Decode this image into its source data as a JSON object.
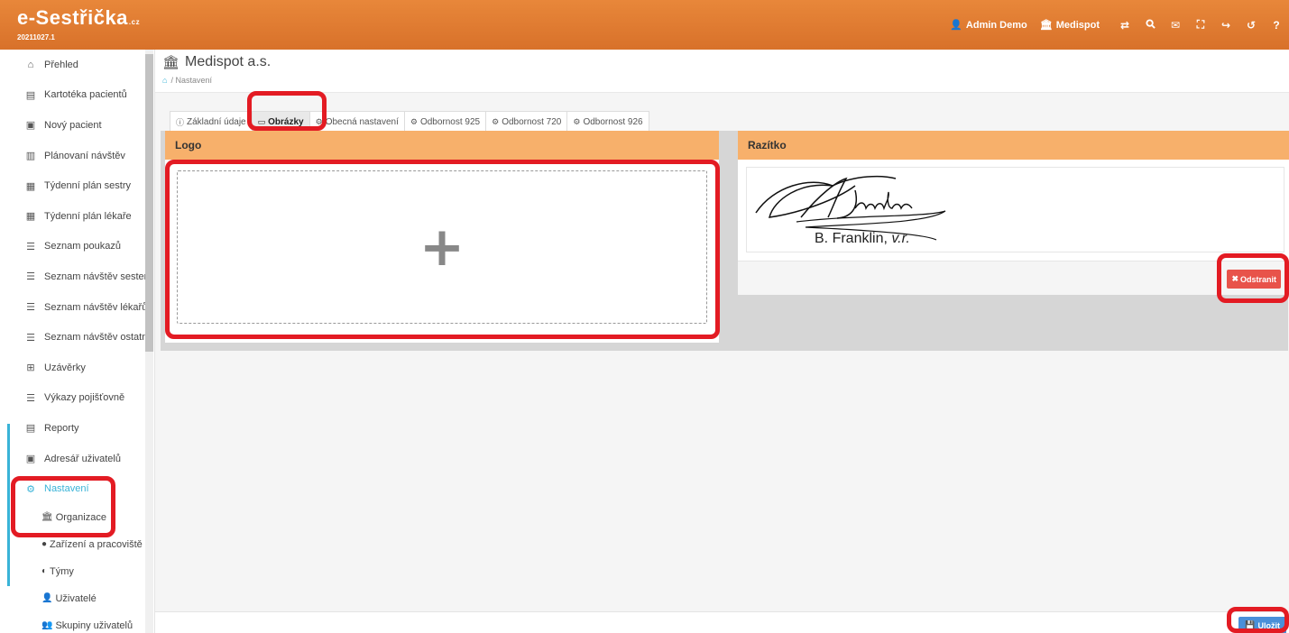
{
  "brand": {
    "name": "e-Sestřička",
    "tld": ".cz",
    "version": "20211027.1"
  },
  "topnav": {
    "user": "Admin Demo",
    "organization": "Medispot",
    "icons": [
      "exchange-icon",
      "search-icon",
      "envelope-icon",
      "fullscreen-icon",
      "logout-icon",
      "history-icon",
      "help-icon"
    ],
    "icon_glyphs": {
      "exchange": "⇄",
      "search": "🔍",
      "envelope": "✉",
      "fullscreen": "⛶",
      "logout": "↪",
      "history": "↺",
      "help": "?"
    }
  },
  "sidebar": {
    "items": [
      {
        "label": "Přehled",
        "icon": "⌂"
      },
      {
        "label": "Kartotéka pacientů",
        "icon": "▤"
      },
      {
        "label": "Nový pacient",
        "icon": "▣"
      },
      {
        "label": "Plánovaní návštěv",
        "icon": "▥"
      },
      {
        "label": "Týdenní plán sestry",
        "icon": "▦"
      },
      {
        "label": "Týdenní plán lékaře",
        "icon": "▦"
      },
      {
        "label": "Seznam poukazů",
        "icon": "☰"
      },
      {
        "label": "Seznam návštěv sester",
        "icon": "☰"
      },
      {
        "label": "Seznam návštěv lékařů",
        "icon": "☰"
      },
      {
        "label": "Seznam návštěv ostatní",
        "icon": "☰"
      },
      {
        "label": "Uzávěrky",
        "icon": "⊞"
      },
      {
        "label": "Výkazy pojišťovně",
        "icon": "☰"
      },
      {
        "label": "Reporty",
        "icon": "▤"
      },
      {
        "label": "Adresář uživatelů",
        "icon": "▣"
      },
      {
        "label": "Nastavení",
        "icon": "⚙"
      }
    ],
    "subitems": [
      {
        "label": "Organizace",
        "icon": "🏛"
      },
      {
        "label": "Zařízení a pracoviště",
        "icon": "●"
      },
      {
        "label": "Týmy",
        "icon": "◐"
      },
      {
        "label": "Uživatelé",
        "icon": "👤"
      },
      {
        "label": "Skupiny uživatelů",
        "icon": "👥"
      }
    ]
  },
  "page": {
    "title": "Medispot a.s.",
    "breadcrumb_current": "Nastavení"
  },
  "tabs": [
    {
      "label": "Základní údaje",
      "icon": "ⓘ"
    },
    {
      "label": "Obrázky",
      "icon": "▭"
    },
    {
      "label": "Obecná nastavení",
      "icon": "⚙"
    },
    {
      "label": "Odbornost 925",
      "icon": "⚙"
    },
    {
      "label": "Odbornost 720",
      "icon": "⚙"
    },
    {
      "label": "Odbornost 926",
      "icon": "⚙"
    }
  ],
  "logo_panel": {
    "title": "Logo",
    "upload_symbol": "+"
  },
  "stamp_panel": {
    "title": "Razítko",
    "signature_caption": "B. Franklin, ",
    "signature_suffix": "v.r.",
    "remove_label": "Odstranit"
  },
  "footer": {
    "save_label": "Uložit"
  },
  "colors": {
    "accent": "#e07a2f",
    "active_link": "#39b3d7",
    "panel_header": "#f7b06b",
    "remove": "#e8534a",
    "save": "#4a90d9",
    "highlight": "#e31b23"
  }
}
